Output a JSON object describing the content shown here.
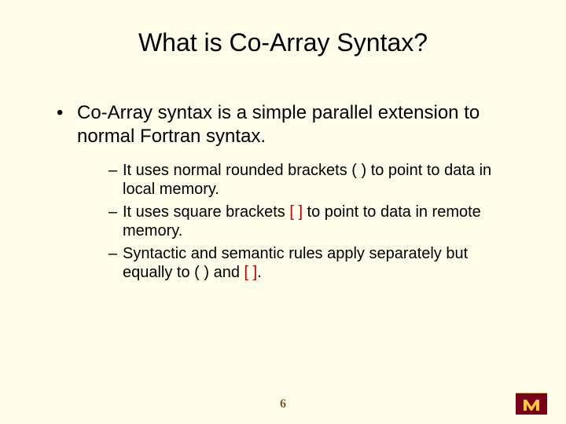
{
  "title": "What is Co-Array Syntax?",
  "main_bullet": "Co-Array syntax is a simple parallel extension to normal Fortran syntax.",
  "sub1_a": "It uses normal rounded brackets ( ) to point to data in local memory.",
  "sub2_a": "It uses square brackets ",
  "sub2_brackets": "[ ]",
  "sub2_b": " to point to data in remote memory.",
  "sub3_a": "Syntactic and semantic rules apply separately but equally to ( ) and ",
  "sub3_brackets": "[ ]",
  "sub3_b": ".",
  "page_number": "6"
}
